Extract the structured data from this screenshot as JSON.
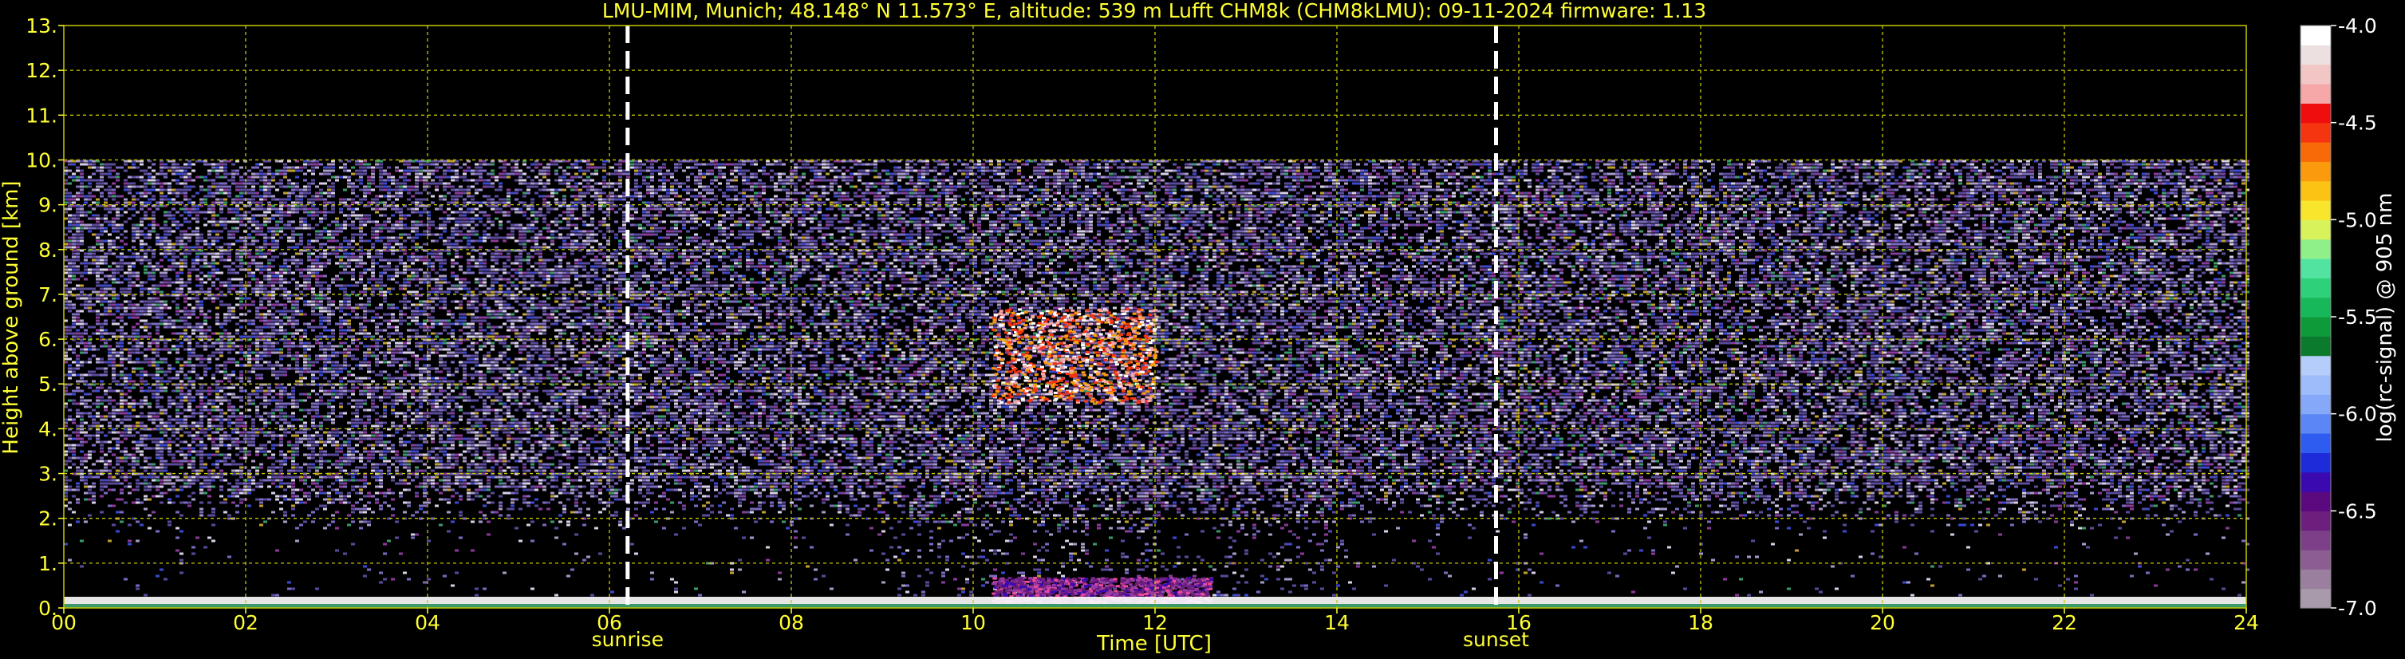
{
  "chart_data": {
    "type": "heatmap",
    "title": "LMU-MIM, Munich; 48.148° N 11.573° E, altitude: 539 m    Lufft CHM8k (CHM8kLMU): 09-11-2024    firmware: 1.13",
    "xlabel": "Time [UTC]",
    "ylabel": "Height above ground [km]",
    "xlim": [
      0,
      24
    ],
    "ylim": [
      0,
      13
    ],
    "x_tick_labels": [
      "00",
      "02",
      "04",
      "06",
      "08",
      "10",
      "12",
      "14",
      "16",
      "18",
      "20",
      "22",
      "24"
    ],
    "y_tick_labels": [
      "0.",
      "1.",
      "2.",
      "3.",
      "4.",
      "5.",
      "6.",
      "7.",
      "8.",
      "9.",
      "10.",
      "11.",
      "12.",
      "13."
    ],
    "grid": true,
    "measurement_ceiling_km": 10,
    "sunrise": {
      "label": "sunrise",
      "time_utc": 6.2
    },
    "sunset": {
      "label": "sunset",
      "time_utc": 15.75
    },
    "cirrus_layer": {
      "start_utc": 10.2,
      "end_utc": 12.0,
      "base_km": 4.6,
      "top_km": 6.7
    },
    "boundary_layer": {
      "start_utc": 10.2,
      "end_utc": 12.6,
      "top_km": 0.7
    },
    "colorbar": {
      "label": "log(rc-signal) @ 905 nm",
      "range": [
        -7.0,
        -4.0
      ],
      "tick_labels": [
        "-4.0",
        "-4.5",
        "-5.0",
        "-5.5",
        "-6.0",
        "-6.5",
        "-7.0"
      ],
      "colors": [
        "#a89aaa",
        "#9a7f9e",
        "#8b5d92",
        "#7c3f88",
        "#6d1f7e",
        "#5a0a7e",
        "#3a0ab0",
        "#1e2bd8",
        "#2f5cf0",
        "#5b86f5",
        "#86a8f8",
        "#9fbcfa",
        "#b5cdfb",
        "#0b7a2c",
        "#0f9a3a",
        "#17b85a",
        "#2fd07a",
        "#53e3a0",
        "#8ff08a",
        "#d7f25a",
        "#f8e52c",
        "#fcc314",
        "#fb9a0c",
        "#f86a08",
        "#f53510",
        "#ef0d0d",
        "#f6a7a7",
        "#f3c6c6",
        "#ece0e0",
        "#ffffff"
      ],
      "colors_tag": "viridis-like custom"
    },
    "colors": {
      "axis_text": "#ffff33",
      "grid": "#c8c800",
      "background": "#000000",
      "event_line": "#ffffff",
      "colorbar_text": "#ffffff"
    }
  }
}
